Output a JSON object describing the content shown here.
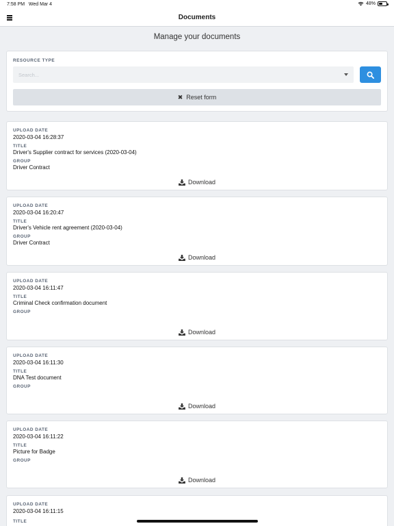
{
  "status": {
    "time": "7:58 PM",
    "date": "Wed Mar 4",
    "battery": "48%",
    "battery_level": 0.48
  },
  "header": {
    "title": "Documents"
  },
  "page": {
    "subtitle": "Manage your documents"
  },
  "filter": {
    "resource_type_label": "RESOURCE TYPE",
    "search_placeholder": "Search...",
    "reset_label": "Reset form"
  },
  "labels": {
    "upload_date": "UPLOAD DATE",
    "title": "TITLE",
    "group": "GROUP",
    "download": "Download"
  },
  "documents": [
    {
      "upload_date": "2020-03-04 16:28:37",
      "title": "Driver's Supplier contract for services (2020-03-04)",
      "group": "Driver Contract"
    },
    {
      "upload_date": "2020-03-04 16:20:47",
      "title": "Driver's Vehicle rent agreement (2020-03-04)",
      "group": "Driver Contract"
    },
    {
      "upload_date": "2020-03-04 16:11:47",
      "title": "Criminal Check confirmation document",
      "group": ""
    },
    {
      "upload_date": "2020-03-04 16:11:30",
      "title": "DNA Test document",
      "group": ""
    },
    {
      "upload_date": "2020-03-04 16:11:22",
      "title": "Picture for Badge",
      "group": ""
    },
    {
      "upload_date": "2020-03-04 16:11:15",
      "title": "",
      "group": ""
    }
  ]
}
